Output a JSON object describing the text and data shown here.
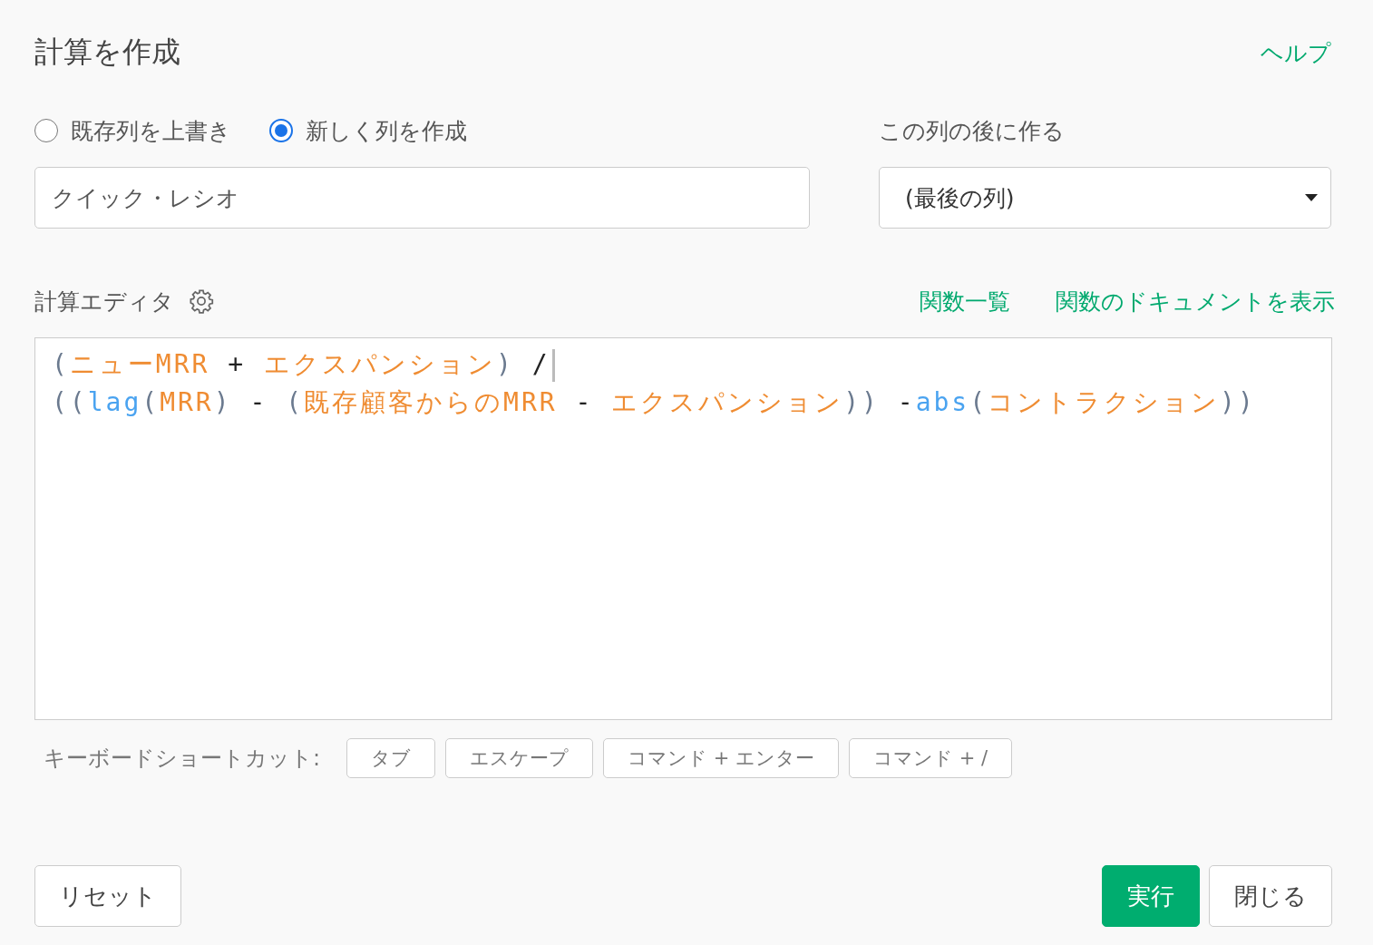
{
  "dialog": {
    "title": "計算を作成",
    "help_link": "ヘルプ"
  },
  "mode_options": [
    {
      "label": "既存列を上書き",
      "selected": false
    },
    {
      "label": "新しく列を作成",
      "selected": true
    }
  ],
  "column_name": {
    "value": "クイック・レシオ"
  },
  "position": {
    "label": "この列の後に作る",
    "value": "(最後の列)"
  },
  "editor": {
    "label": "計算エディタ",
    "links": [
      "関数一覧",
      "関数のドキュメントを表示"
    ],
    "lines": [
      [
        {
          "kind": "paren",
          "text": "("
        },
        {
          "kind": "field",
          "text": "ニューMRR"
        },
        {
          "kind": "op",
          "text": " + "
        },
        {
          "kind": "field",
          "text": "エクスパンション"
        },
        {
          "kind": "paren",
          "text": ")"
        },
        {
          "kind": "op",
          "text": " /"
        }
      ],
      [
        {
          "kind": "paren",
          "text": "(("
        },
        {
          "kind": "func",
          "text": "lag"
        },
        {
          "kind": "paren",
          "text": "("
        },
        {
          "kind": "field",
          "text": "MRR"
        },
        {
          "kind": "paren",
          "text": ")"
        },
        {
          "kind": "op",
          "text": " - "
        },
        {
          "kind": "paren",
          "text": "("
        },
        {
          "kind": "field",
          "text": "既存顧客からのMRR"
        },
        {
          "kind": "op",
          "text": " - "
        },
        {
          "kind": "field",
          "text": "エクスパンション"
        },
        {
          "kind": "paren",
          "text": "))"
        },
        {
          "kind": "op",
          "text": " -"
        },
        {
          "kind": "func",
          "text": "abs"
        },
        {
          "kind": "paren",
          "text": "("
        },
        {
          "kind": "field",
          "text": "コントラクション"
        },
        {
          "kind": "paren",
          "text": "))"
        }
      ]
    ]
  },
  "shortcuts": {
    "label": "キーボードショートカット:",
    "keys": [
      "タブ",
      "エスケープ",
      "コマンド + エンター",
      "コマンド + /"
    ]
  },
  "buttons": {
    "reset": "リセット",
    "run": "実行",
    "close": "閉じる"
  }
}
